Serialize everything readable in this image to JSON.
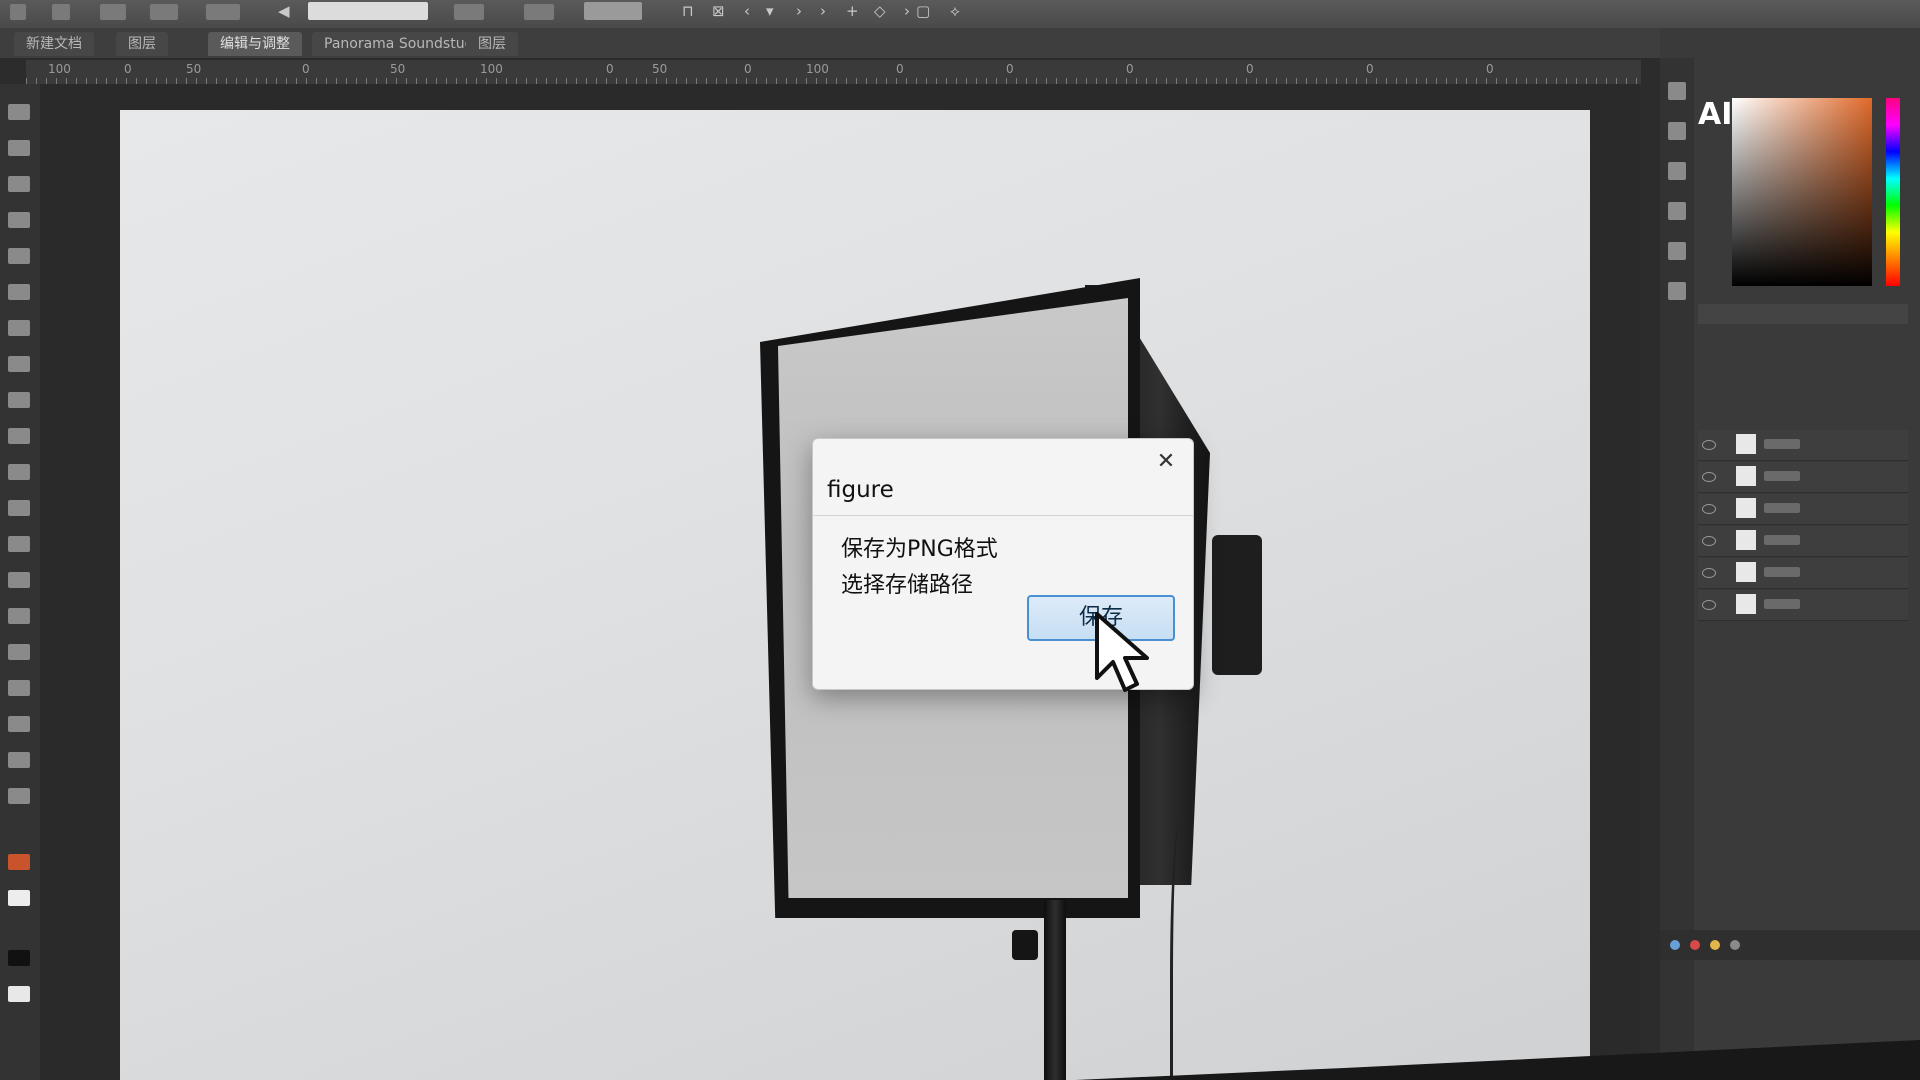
{
  "tabs": [
    {
      "label": "新建文档"
    },
    {
      "label": "图层"
    },
    {
      "label": "编辑与调整"
    },
    {
      "label": "Panorama Soundstudio"
    },
    {
      "label": "图层"
    }
  ],
  "ruler": {
    "top_numbers": [
      "100",
      "0",
      "50",
      "0",
      "50",
      "100",
      "0",
      "50",
      "0",
      "100",
      "0",
      "0",
      "0",
      "0",
      "0",
      "0"
    ]
  },
  "right_panel": {
    "logo": "AI",
    "layers": [
      {
        "name": ""
      },
      {
        "name": ""
      },
      {
        "name": ""
      },
      {
        "name": ""
      },
      {
        "name": ""
      },
      {
        "name": ""
      }
    ]
  },
  "dialog": {
    "title": "figure",
    "close_glyph": "✕",
    "line1": "保存为PNG格式",
    "line2": "选择存储路径",
    "button_label": "保存"
  },
  "colors": {
    "dialog_button_border": "#4a8fd1",
    "canvas": "#e3e5e7",
    "softbox_frame": "#151515"
  },
  "icons": {
    "close": "close-icon",
    "cursor": "mouse-pointer-icon",
    "ai_logo": "ai-logo",
    "eye": "eye-icon"
  }
}
